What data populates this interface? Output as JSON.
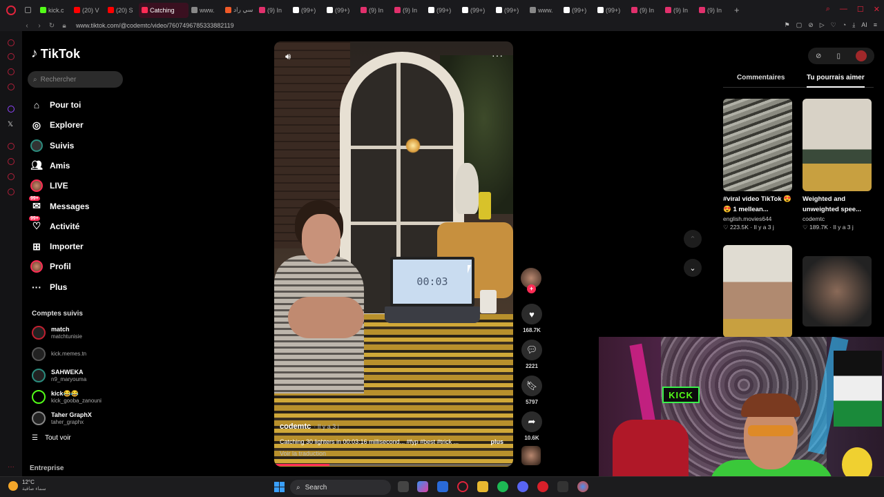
{
  "browser": {
    "tabs": [
      {
        "label": "kick.c",
        "color": "#53fc18"
      },
      {
        "label": "(20) V",
        "color": "#ff0000"
      },
      {
        "label": "(20) S",
        "color": "#ff0000"
      },
      {
        "label": "Catching",
        "color": "#fe2c55",
        "active": true
      },
      {
        "label": "www.",
        "color": "#888888"
      },
      {
        "label": "سي راد",
        "color": "#f05a28"
      },
      {
        "label": "(9) In",
        "color": "#e1306c"
      },
      {
        "label": "(99+)",
        "color": "#ffffff"
      },
      {
        "label": "(99+)",
        "color": "#ffffff"
      },
      {
        "label": "(9) In",
        "color": "#e1306c"
      },
      {
        "label": "(9) In",
        "color": "#e1306c"
      },
      {
        "label": "(99+)",
        "color": "#ffffff"
      },
      {
        "label": "(99+)",
        "color": "#ffffff"
      },
      {
        "label": "(99+)",
        "color": "#ffffff"
      },
      {
        "label": "www.",
        "color": "#888888"
      },
      {
        "label": "(99+)",
        "color": "#ffffff"
      },
      {
        "label": "(99+)",
        "color": "#ffffff"
      },
      {
        "label": "(9) In",
        "color": "#e1306c"
      },
      {
        "label": "(9) In",
        "color": "#e1306c"
      },
      {
        "label": "(9) In",
        "color": "#e1306c"
      }
    ],
    "url": "www.tiktok.com/@codemtc/video/7607496785333882119",
    "ai_label": "AI"
  },
  "nav": {
    "logo": "TikTok",
    "search_placeholder": "Rechercher",
    "items": [
      {
        "label": "Pour toi",
        "icon": "home-icon"
      },
      {
        "label": "Explorer",
        "icon": "compass-icon"
      },
      {
        "label": "Suivis",
        "icon": "following-icon"
      },
      {
        "label": "Amis",
        "icon": "friends-icon"
      },
      {
        "label": "LIVE",
        "icon": "live-icon"
      },
      {
        "label": "Messages",
        "icon": "messages-icon",
        "badge": "99+"
      },
      {
        "label": "Activité",
        "icon": "activity-icon",
        "badge": "99+"
      },
      {
        "label": "Importer",
        "icon": "upload-icon"
      },
      {
        "label": "Profil",
        "icon": "profile-icon"
      },
      {
        "label": "Plus",
        "icon": "more-icon"
      }
    ],
    "followed_title": "Comptes suivis",
    "accounts": [
      {
        "name": "match",
        "handle": "matchtunisie"
      },
      {
        "name": "",
        "handle": "kick.memes.tn"
      },
      {
        "name": "SAHWEKA",
        "handle": "n9_maryouma"
      },
      {
        "name": "kick😂😂",
        "handle": "kick_gooba_zanouni"
      },
      {
        "name": "Taher GraphX",
        "handle": "taher_graphx"
      }
    ],
    "see_all": "Tout voir",
    "entreprise": "Entreprise"
  },
  "video": {
    "timer": "00:03",
    "author": "codemtc",
    "ago": "· Il y a 3 j",
    "caption": "Catching 30 lighters in 00:03:16 millisecond... #fyp #best #trick ...",
    "more": "plus",
    "translate": "Voir la traduction",
    "progress": 0.23
  },
  "actions": {
    "likes": "168.7K",
    "comments": "2221",
    "saves": "5797",
    "shares": "10.6K"
  },
  "panel": {
    "tab_comments": "Commentaires",
    "tab_suggest": "Tu pourrais aimer",
    "cards": [
      {
        "title": "#viral video TikTok 😍😍 1 mellean...",
        "author": "english.movies644",
        "meta": "♡ 223.5K · Il y a 3 j"
      },
      {
        "title": "Weighted and unweighted spee...",
        "author": "codemtc",
        "meta": "♡ 189.7K · Il y a 3 j"
      }
    ]
  },
  "taskbar": {
    "temp": "12°C",
    "weather": "سماء صافية",
    "search": "Search"
  }
}
